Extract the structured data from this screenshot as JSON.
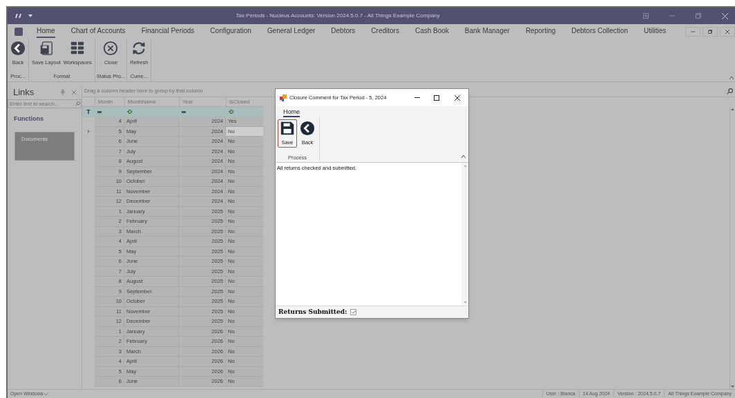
{
  "window": {
    "title": "Tax Periods - Nucleus Accounts: Version 2024.5.0.7 - All Things Example Company"
  },
  "menu_tabs": [
    {
      "label": "Home",
      "selected": true
    },
    {
      "label": "Chart of Accounts",
      "selected": false
    },
    {
      "label": "Financial Periods",
      "selected": false
    },
    {
      "label": "Configuration",
      "selected": false
    },
    {
      "label": "General Ledger",
      "selected": false
    },
    {
      "label": "Debtors",
      "selected": false
    },
    {
      "label": "Creditors",
      "selected": false
    },
    {
      "label": "Cash Book",
      "selected": false
    },
    {
      "label": "Bank Manager",
      "selected": false
    },
    {
      "label": "Reporting",
      "selected": false
    },
    {
      "label": "Debtors Collection",
      "selected": false
    },
    {
      "label": "Utilities",
      "selected": false
    }
  ],
  "ribbon_groups": [
    {
      "label": "Proc...",
      "buttons": [
        {
          "label": "Back",
          "kind": "back"
        }
      ]
    },
    {
      "label": "Format",
      "buttons": [
        {
          "label": "Save Layout",
          "kind": "layout"
        },
        {
          "label": "Workspaces",
          "kind": "grid"
        }
      ]
    },
    {
      "label": "Status Pro...",
      "buttons": [
        {
          "label": "Close",
          "kind": "close"
        }
      ]
    },
    {
      "label": "Curre...",
      "buttons": [
        {
          "label": "Refresh",
          "kind": "refresh"
        }
      ]
    }
  ],
  "links": {
    "title": "Links",
    "search_placeholder": "Enter text to search...",
    "section": "Functions",
    "tiles": [
      "Documents"
    ]
  },
  "grid": {
    "group_hint": "Drag a column header here to group by that column",
    "columns": [
      "Month",
      "MonthName",
      "Year",
      "IsClosed"
    ],
    "rows": [
      {
        "month": "4",
        "name": "April",
        "year": "2024",
        "closed": "Yes",
        "selected": false
      },
      {
        "month": "5",
        "name": "May",
        "year": "2024",
        "closed": "No",
        "selected": true
      },
      {
        "month": "6",
        "name": "June",
        "year": "2024",
        "closed": "No",
        "selected": false
      },
      {
        "month": "7",
        "name": "July",
        "year": "2024",
        "closed": "No",
        "selected": false
      },
      {
        "month": "8",
        "name": "August",
        "year": "2024",
        "closed": "No",
        "selected": false
      },
      {
        "month": "9",
        "name": "September",
        "year": "2024",
        "closed": "No",
        "selected": false
      },
      {
        "month": "10",
        "name": "October",
        "year": "2024",
        "closed": "No",
        "selected": false
      },
      {
        "month": "11",
        "name": "November",
        "year": "2024",
        "closed": "No",
        "selected": false
      },
      {
        "month": "12",
        "name": "December",
        "year": "2024",
        "closed": "No",
        "selected": false
      },
      {
        "month": "1",
        "name": "January",
        "year": "2025",
        "closed": "No",
        "selected": false
      },
      {
        "month": "2",
        "name": "February",
        "year": "2025",
        "closed": "No",
        "selected": false
      },
      {
        "month": "3",
        "name": "March",
        "year": "2025",
        "closed": "No",
        "selected": false
      },
      {
        "month": "4",
        "name": "April",
        "year": "2025",
        "closed": "No",
        "selected": false
      },
      {
        "month": "5",
        "name": "May",
        "year": "2025",
        "closed": "No",
        "selected": false
      },
      {
        "month": "6",
        "name": "June",
        "year": "2025",
        "closed": "No",
        "selected": false
      },
      {
        "month": "7",
        "name": "July",
        "year": "2025",
        "closed": "No",
        "selected": false
      },
      {
        "month": "8",
        "name": "August",
        "year": "2025",
        "closed": "No",
        "selected": false
      },
      {
        "month": "9",
        "name": "September",
        "year": "2025",
        "closed": "No",
        "selected": false
      },
      {
        "month": "10",
        "name": "October",
        "year": "2025",
        "closed": "No",
        "selected": false
      },
      {
        "month": "11",
        "name": "November",
        "year": "2025",
        "closed": "No",
        "selected": false
      },
      {
        "month": "12",
        "name": "December",
        "year": "2025",
        "closed": "No",
        "selected": false
      },
      {
        "month": "1",
        "name": "January",
        "year": "2026",
        "closed": "No",
        "selected": false
      },
      {
        "month": "2",
        "name": "February",
        "year": "2026",
        "closed": "No",
        "selected": false
      },
      {
        "month": "3",
        "name": "March",
        "year": "2026",
        "closed": "No",
        "selected": false
      },
      {
        "month": "4",
        "name": "April",
        "year": "2026",
        "closed": "No",
        "selected": false
      },
      {
        "month": "5",
        "name": "May",
        "year": "2026",
        "closed": "No",
        "selected": false
      },
      {
        "month": "6",
        "name": "June",
        "year": "2026",
        "closed": "No",
        "selected": false
      }
    ]
  },
  "dialog": {
    "title": "Closure Comment for Tax Period - 5, 2024",
    "tab": "Home",
    "group": "Process",
    "buttons": [
      {
        "label": "Save",
        "kind": "save",
        "focused": true
      },
      {
        "label": "Back",
        "kind": "back",
        "focused": false
      }
    ],
    "comment": "All returns checked and submitted.",
    "checkbox_label": "Returns Submitted:",
    "checked": true
  },
  "status_bar": {
    "open_windows": "Open Windows",
    "items": [
      "User : Bianca",
      "14 Aug 2024",
      "Version : 2024.5.0.7",
      "All Things Example Company"
    ]
  }
}
